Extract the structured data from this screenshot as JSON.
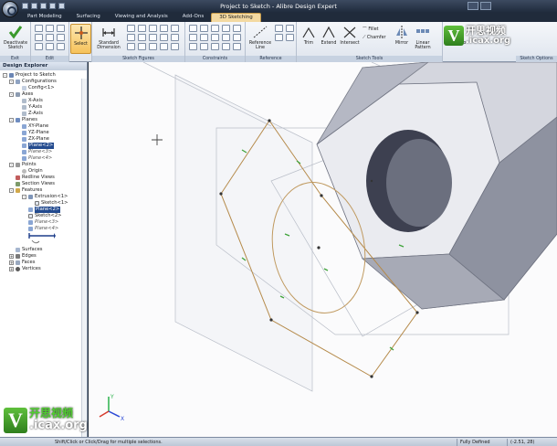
{
  "window": {
    "title": "Project to Sketch - Alibre Design Expert"
  },
  "tabs": [
    {
      "label": "Part Modeling"
    },
    {
      "label": "Surfacing"
    },
    {
      "label": "Viewing and Analysis"
    },
    {
      "label": "Add-Ons"
    },
    {
      "label": "3D Sketching"
    }
  ],
  "ribbon": {
    "exit": {
      "deactivate_label": "Deactivate Sketch",
      "group_label": "Exit"
    },
    "edit": {
      "group_label": "Edit"
    },
    "select": {
      "label": "Select"
    },
    "sketch_figures": {
      "standard_dimension_label": "Standard Dimension",
      "group_label": "Sketch Figures"
    },
    "constraints": {
      "group_label": "Constraints"
    },
    "reference": {
      "reference_line_label": "Reference Line",
      "group_label": "Reference"
    },
    "sketch_tools": {
      "trim_label": "Trim",
      "extend_label": "Extend",
      "intersect_label": "Intersect",
      "fillet_label": "Fillet",
      "chamfer_label": "Chamfer",
      "mirror_label": "Mirror",
      "linear_pattern_label": "Linear Pattern",
      "project_label": "Project to",
      "group_label": "Sketch Tools"
    },
    "sketch_options": {
      "group_label": "Sketch Options"
    }
  },
  "explorer": {
    "title": "Design Explorer",
    "nodes": [
      {
        "label": "Project to Sketch"
      },
      {
        "label": "Configurations"
      },
      {
        "label": "Config<1>"
      },
      {
        "label": "Axes"
      },
      {
        "label": "X-Axis"
      },
      {
        "label": "Y-Axis"
      },
      {
        "label": "Z-Axis"
      },
      {
        "label": "Planes"
      },
      {
        "label": "XY-Plane"
      },
      {
        "label": "YZ-Plane"
      },
      {
        "label": "ZX-Plane"
      },
      {
        "label": "Plane<2>"
      },
      {
        "label": "Plane<3>"
      },
      {
        "label": "Plane<4>"
      },
      {
        "label": "Points"
      },
      {
        "label": "Origin"
      },
      {
        "label": "Redline Views"
      },
      {
        "label": "Section Views"
      },
      {
        "label": "Features"
      },
      {
        "label": "Extrusion<1>"
      },
      {
        "label": "Sketch<1>"
      },
      {
        "label": "Plane<2>"
      },
      {
        "label": "Sketch<2>"
      },
      {
        "label": "Plane<3>"
      },
      {
        "label": "Plane<4>"
      },
      {
        "label": "Surfaces"
      },
      {
        "label": "Edges"
      },
      {
        "label": "Faces"
      },
      {
        "label": "Vertices"
      }
    ]
  },
  "status": {
    "message": "Shift/Click or Click/Drag for multiple selections.",
    "definition": "Fully Defined",
    "coordinates": "(-2.51, 28)"
  },
  "watermark": {
    "brand_cn": "开思视频",
    "domain": ".icax.org",
    "v": "V"
  },
  "colors": {
    "accent_tab": "#f3d9a1",
    "selection": "#244b8f",
    "sketch_line": "#b58a4a",
    "constraint_marker": "#3fa33a",
    "nut_face": "#c9ccd6"
  }
}
